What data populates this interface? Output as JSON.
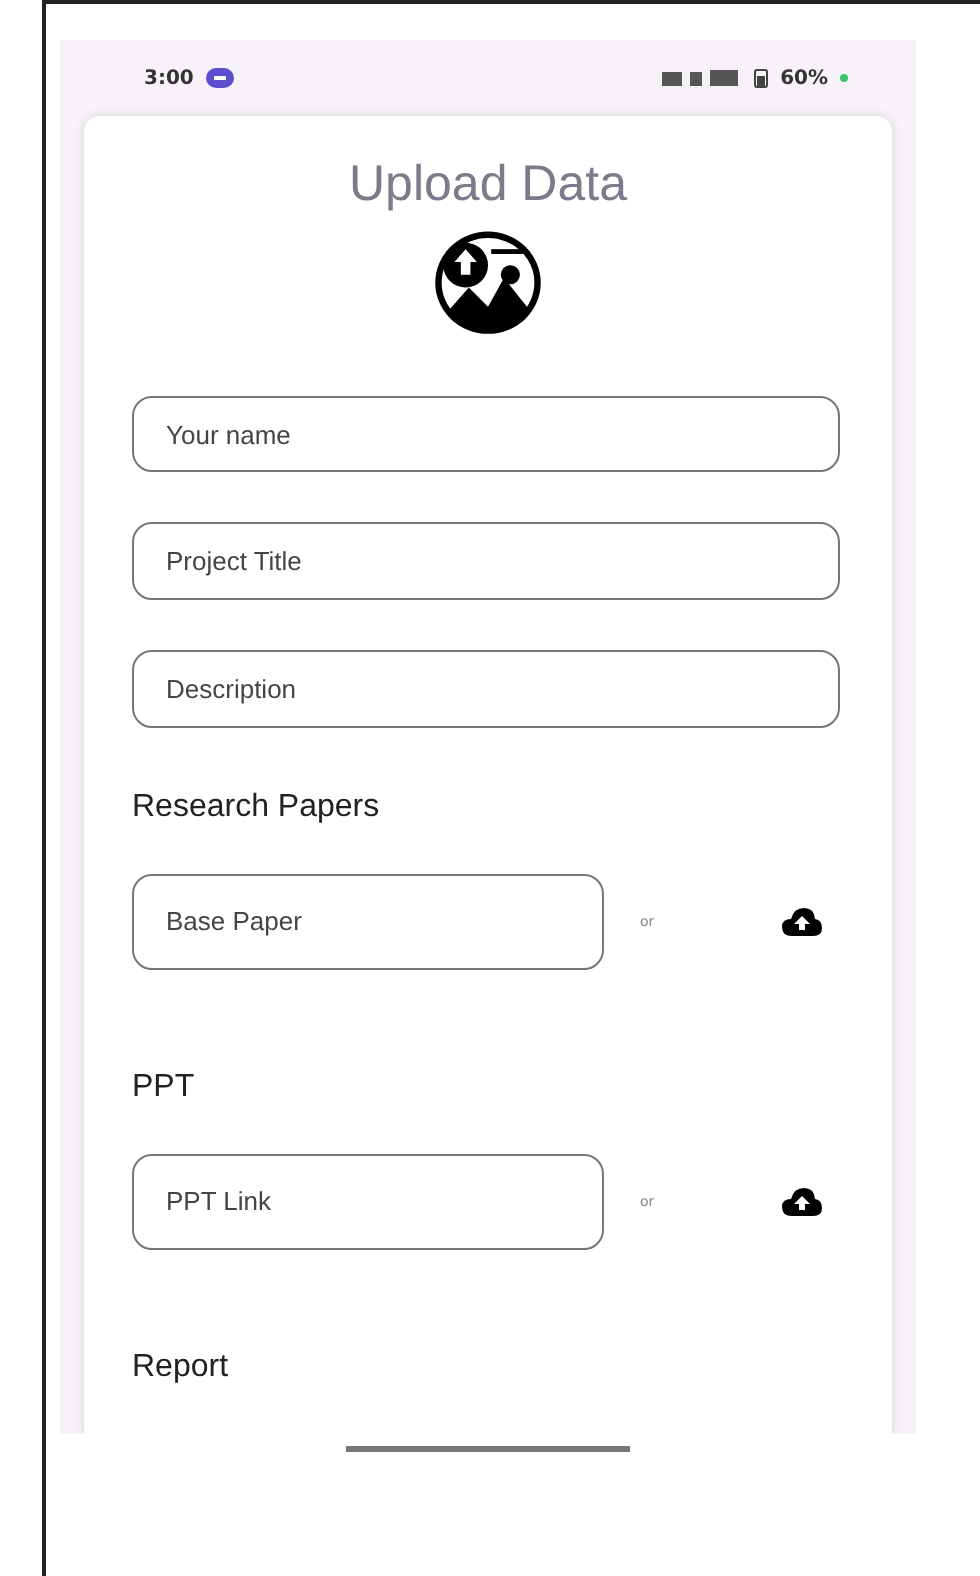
{
  "status_bar": {
    "time": "3:00",
    "battery": "60%"
  },
  "title": "Upload Data",
  "fields": [
    {
      "placeholder": "Your name"
    },
    {
      "placeholder": "Project Title"
    },
    {
      "placeholder": "Description"
    }
  ],
  "sections": [
    {
      "heading": "Research Papers",
      "field": {
        "placeholder": "Base Paper"
      },
      "separator": "or"
    },
    {
      "heading": "PPT",
      "field": {
        "placeholder": "PPT Link"
      },
      "separator": "or"
    },
    {
      "heading": "Report"
    }
  ]
}
